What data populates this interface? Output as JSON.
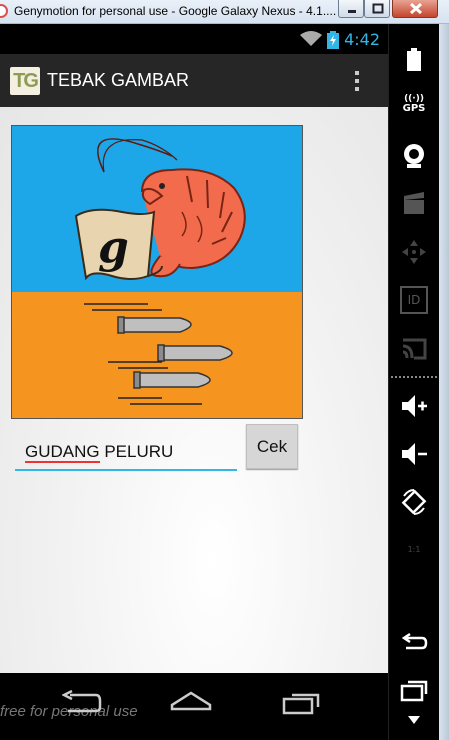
{
  "window": {
    "title": "Genymotion for personal use - Google Galaxy Nexus - 4.1...."
  },
  "status_bar": {
    "time": "4:42"
  },
  "action_bar": {
    "logo_text": "TG",
    "title": "TEBAK GAMBAR"
  },
  "puzzle": {
    "letter": "g"
  },
  "answer": {
    "first_word": "GUDANG",
    "rest": " PELURU"
  },
  "check_button": {
    "label": "Cek"
  },
  "nav_bar": {
    "watermark": "free for personal use"
  },
  "sidebar": {
    "gps_label": "GPS",
    "id_label": "ID",
    "scale_label": "1:1"
  },
  "colors": {
    "sky": "#1da6e8",
    "ground": "#f59520",
    "accent": "#33b5e5"
  }
}
